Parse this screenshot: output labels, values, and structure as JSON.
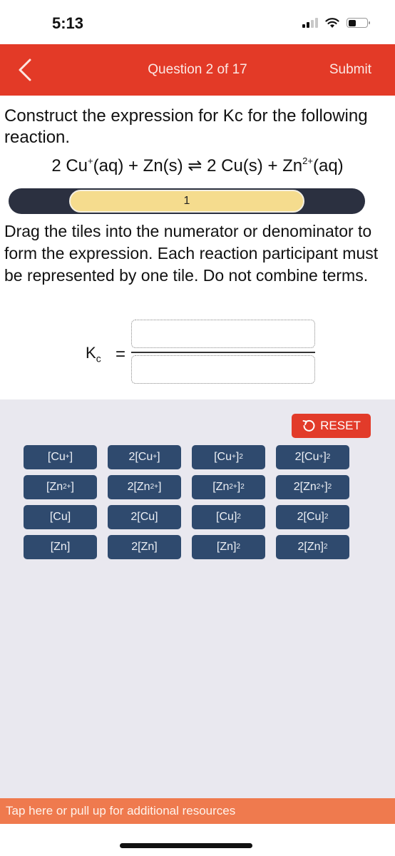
{
  "status_bar": {
    "time": "5:13",
    "icons": [
      "cellular-signal-icon",
      "wifi-icon",
      "battery-icon"
    ]
  },
  "header": {
    "back_icon": "chevron-left-icon",
    "title": "Question 2 of 17",
    "submit_label": "Submit",
    "color": "#e33a27"
  },
  "question": {
    "prompt": "Construct the expression for Kc for the following reaction.",
    "equation": {
      "reactant1_coef": "2 ",
      "reactant1": "Cu",
      "reactant1_charge": "+",
      "reactant1_state": "(aq) + Zn(s) ",
      "arrow": "⇌",
      "product1": " 2 Cu(s) + Zn",
      "product2_charge": "2+",
      "product2_state": "(aq)"
    }
  },
  "slider": {
    "value": "1",
    "track_color": "#2b3040",
    "thumb_color": "#f5dc8e"
  },
  "instructions": "Drag the tiles into the numerator or denominator to form the expression. Each reaction participant must be represented by one tile. Do not combine terms.",
  "expression": {
    "kc_label": "K",
    "kc_sub": "c",
    "equals": "=",
    "numerator": "",
    "denominator": ""
  },
  "reset": {
    "label": "RESET",
    "icon": "undo-icon",
    "color": "#e23b2a"
  },
  "tiles": [
    {
      "base": "[Cu",
      "sup1": "+",
      "close": "]",
      "sup2": ""
    },
    {
      "base": "2[Cu",
      "sup1": "+",
      "close": "]",
      "sup2": ""
    },
    {
      "base": "[Cu",
      "sup1": "+",
      "close": "]",
      "sup2": "2"
    },
    {
      "base": "2[Cu",
      "sup1": "+",
      "close": "]",
      "sup2": "2"
    },
    {
      "base": "[Zn",
      "sup1": "2+",
      "close": "]",
      "sup2": ""
    },
    {
      "base": "2[Zn",
      "sup1": "2+",
      "close": "]",
      "sup2": ""
    },
    {
      "base": "[Zn",
      "sup1": "2+",
      "close": "]",
      "sup2": "2"
    },
    {
      "base": "2[Zn",
      "sup1": "2+",
      "close": "]",
      "sup2": "2"
    },
    {
      "base": "[Cu",
      "sup1": "",
      "close": "]",
      "sup2": ""
    },
    {
      "base": "2[Cu",
      "sup1": "",
      "close": "]",
      "sup2": ""
    },
    {
      "base": "[Cu",
      "sup1": "",
      "close": "]",
      "sup2": "2"
    },
    {
      "base": "2[Cu",
      "sup1": "",
      "close": "]",
      "sup2": "2"
    },
    {
      "base": "[Zn",
      "sup1": "",
      "close": "]",
      "sup2": ""
    },
    {
      "base": "2[Zn",
      "sup1": "",
      "close": "]",
      "sup2": ""
    },
    {
      "base": "[Zn",
      "sup1": "",
      "close": "]",
      "sup2": "2"
    },
    {
      "base": "2[Zn",
      "sup1": "",
      "close": "]",
      "sup2": "2"
    }
  ],
  "tile_color": "#2f4a6e",
  "resources": {
    "label": "Tap here or pull up for additional resources",
    "color": "#ef7a4e"
  }
}
